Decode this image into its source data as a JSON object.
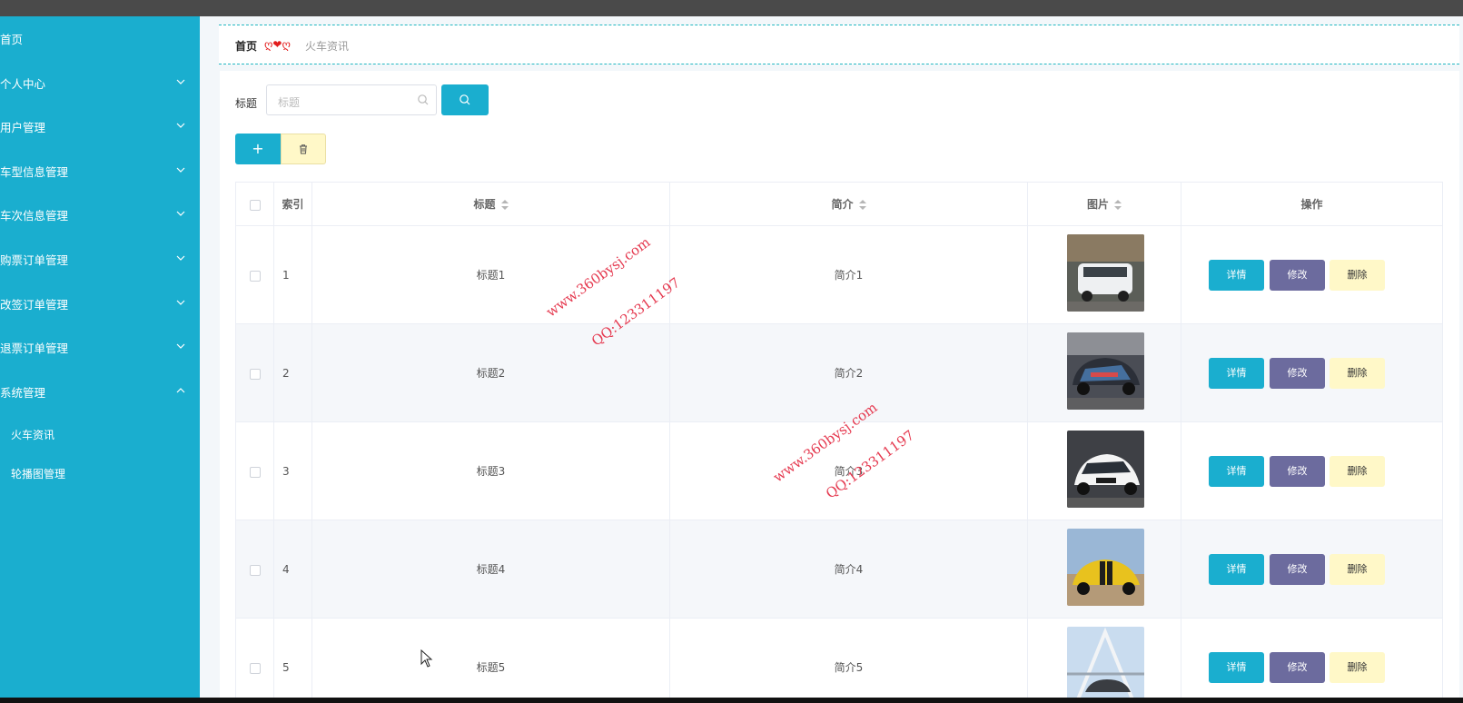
{
  "sidebar": {
    "items": [
      {
        "label": "首页",
        "expandable": false
      },
      {
        "label": "个人中心",
        "expandable": true,
        "expanded": false
      },
      {
        "label": "用户管理",
        "expandable": true,
        "expanded": false
      },
      {
        "label": "车型信息管理",
        "expandable": true,
        "expanded": false
      },
      {
        "label": "车次信息管理",
        "expandable": true,
        "expanded": false
      },
      {
        "label": "购票订单管理",
        "expandable": true,
        "expanded": false
      },
      {
        "label": "改签订单管理",
        "expandable": true,
        "expanded": false
      },
      {
        "label": "退票订单管理",
        "expandable": true,
        "expanded": false
      },
      {
        "label": "系统管理",
        "expandable": true,
        "expanded": true
      }
    ],
    "subitems": [
      {
        "label": "火车资讯"
      },
      {
        "label": "轮播图管理"
      }
    ]
  },
  "breadcrumb": {
    "home": "首页",
    "separator": "ღ❤ღ",
    "current": "火车资讯"
  },
  "search": {
    "label": "标题",
    "placeholder": "标题"
  },
  "toolbar": {
    "add_label": "+"
  },
  "table": {
    "columns": [
      "索引",
      "标题",
      "简介",
      "图片",
      "操作"
    ],
    "rows": [
      {
        "index": "1",
        "title": "标题1",
        "intro": "简介1",
        "image": "white-suv"
      },
      {
        "index": "2",
        "title": "标题2",
        "intro": "简介2",
        "image": "wrapped-sports-car"
      },
      {
        "index": "3",
        "title": "标题3",
        "intro": "简介3",
        "image": "white-hatchback"
      },
      {
        "index": "4",
        "title": "标题4",
        "intro": "简介4",
        "image": "yellow-muscle-car"
      },
      {
        "index": "5",
        "title": "标题5",
        "intro": "简介5",
        "image": "car-on-bridge"
      }
    ],
    "actions": {
      "detail": "详情",
      "edit": "修改",
      "delete": "删除"
    }
  },
  "watermarks": [
    {
      "line1": "www.360bysj.com",
      "line2": "QQ:123311197"
    },
    {
      "line1": "www.360bysj.com",
      "line2": "QQ:123311197"
    }
  ],
  "colors": {
    "accent": "#1aaecf",
    "edit": "#6c6b9e",
    "delete": "#fff8c8",
    "watermark": "#e53a50"
  }
}
